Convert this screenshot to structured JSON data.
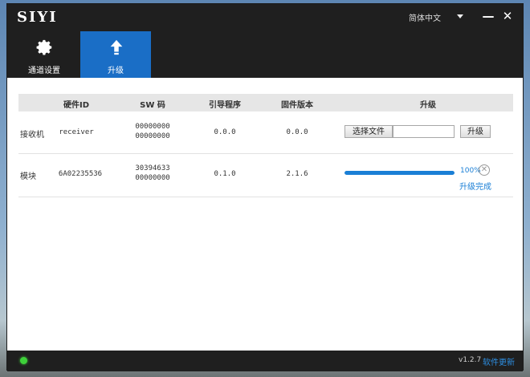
{
  "window": {
    "brand": "SIYI",
    "language": "简体中文",
    "minimize": "—",
    "close": "✕"
  },
  "toolbar": {
    "items": [
      {
        "label": "通道设置",
        "icon": "gear-icon",
        "active": false
      },
      {
        "label": "升级",
        "icon": "upload-arrow-icon",
        "active": true
      }
    ]
  },
  "table": {
    "headers": [
      "硬件ID",
      "SW 码",
      "引导程序",
      "固件版本",
      "升级"
    ],
    "rows": [
      {
        "name": "接收机",
        "hardware_id": "receiver",
        "sw_code_1": "00000000",
        "sw_code_2": "00000000",
        "bootloader": "0.0.0",
        "firmware": "0.0.0",
        "choose_file_label": "选择文件",
        "file_path": "",
        "upgrade_label": "升级"
      },
      {
        "name": "模块",
        "hardware_id": "6A02235536",
        "sw_code_1": "30394633",
        "sw_code_2": "00000000",
        "bootloader": "0.1.0",
        "firmware": "2.1.6",
        "progress": 100,
        "progress_text": "100%",
        "cancel": "✕",
        "status": "升级完成"
      }
    ]
  },
  "statusbar": {
    "connection_color": "#3ed13a",
    "version": "v1.2.7",
    "update_link": "软件更新"
  },
  "colors": {
    "accent": "#1a6ec6",
    "titlebar": "#1f1f1f"
  }
}
